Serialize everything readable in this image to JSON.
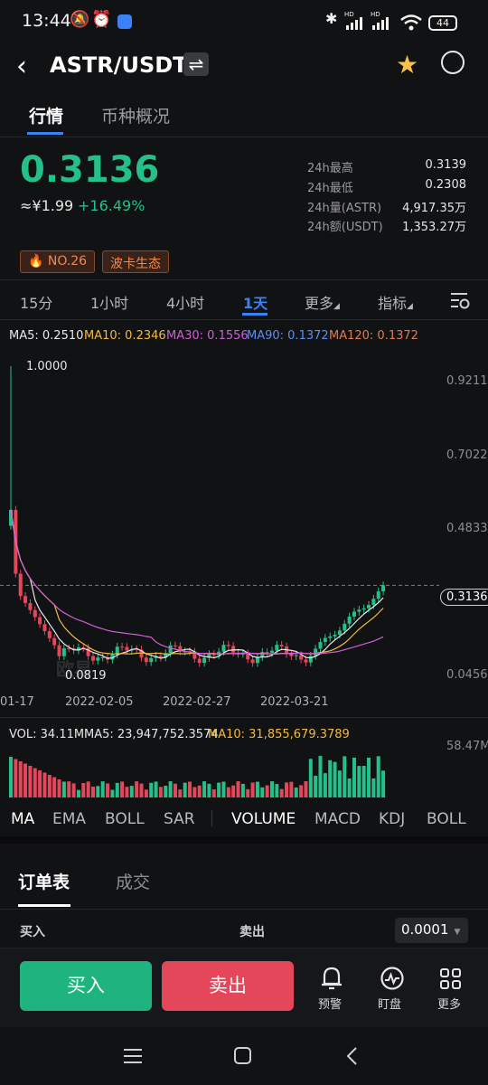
{
  "status_bar": {
    "time": "13:44",
    "battery": "44",
    "icons": [
      "mute-icon",
      "alarm-icon",
      "app-notification-icon",
      "bluetooth-icon",
      "signal-icon",
      "signal-icon",
      "wifi-icon",
      "battery-icon"
    ],
    "hd_label": "HD"
  },
  "header": {
    "title": "ASTR/USDT",
    "swap_glyph": "⇌",
    "back_glyph": "‹",
    "star_glyph": "★"
  },
  "tabs": [
    {
      "label": "行情"
    },
    {
      "label": "币种概况"
    }
  ],
  "ticker": {
    "last_price": "0.3136",
    "cny_price": "≈¥1.99",
    "change": "+16.49%",
    "stats": [
      {
        "label": "24h最高",
        "value": "0.3139"
      },
      {
        "label": "24h最低",
        "value": "0.2308"
      },
      {
        "label": "24h量(ASTR)",
        "value": "4,917.35万"
      },
      {
        "label": "24h额(USDT)",
        "value": "1,353.27万"
      }
    ]
  },
  "tags": [
    {
      "label": "NO.26",
      "icon": "fire-icon"
    },
    {
      "label": "波卡生态"
    }
  ],
  "periods": [
    "15分",
    "1小时",
    "4小时",
    "1天",
    "更多",
    "指标"
  ],
  "ma_line": [
    {
      "text": "MA5: 0.2510",
      "color": "#e8e8e8"
    },
    {
      "text": "MA10: 0.2346",
      "color": "#f5b93f"
    },
    {
      "text": "MA30: 0.1556",
      "color": "#cf5fd6"
    },
    {
      "text": "MA90: 0.1372",
      "color": "#5a8ff0"
    },
    {
      "text": "MA120: 0.1372",
      "color": "#e07a55"
    }
  ],
  "chart_data": {
    "type": "candlestick",
    "y_ticks": [
      "0.9211",
      "0.7022",
      "0.4833",
      "0.3136",
      "0.0456"
    ],
    "x_ticks": [
      "01-17",
      "2022-02-05",
      "2022-02-27",
      "2022-03-21"
    ],
    "high_label": "1.0000",
    "low_label": "0.0819",
    "current_price": "0.3136",
    "ylim": [
      0.0456,
      1.0
    ],
    "up_color": "#25c089",
    "down_color": "#e5475a",
    "volume": {
      "label": "VOL: 34.11M",
      "ma5": "MA5: 23,947,752.3574",
      "ma10": "MA10: 31,855,679.3789",
      "max_label": "58.47M"
    },
    "watermark": "欧易"
  },
  "indicators": [
    "MA",
    "EMA",
    "BOLL",
    "SAR",
    "VOLUME",
    "MACD",
    "KDJ",
    "BOLL"
  ],
  "order_book": {
    "tabs": [
      "订单表",
      "成交"
    ],
    "buy_label": "买入",
    "sell_label": "卖出",
    "precision": "0.0001"
  },
  "actions": {
    "buy": "买入",
    "sell": "卖出",
    "alert": "预警",
    "watch": "盯盘",
    "more": "更多"
  },
  "colors": {
    "accent": "#3b82f6",
    "up": "#25c089",
    "down": "#e5475a",
    "background": "#111214"
  }
}
